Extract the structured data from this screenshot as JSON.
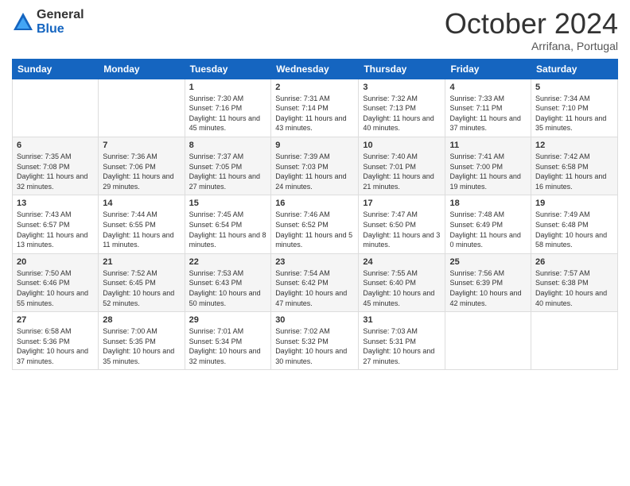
{
  "logo": {
    "general": "General",
    "blue": "Blue"
  },
  "title": "October 2024",
  "subtitle": "Arrifana, Portugal",
  "weekdays": [
    "Sunday",
    "Monday",
    "Tuesday",
    "Wednesday",
    "Thursday",
    "Friday",
    "Saturday"
  ],
  "weeks": [
    [
      {
        "day": "",
        "info": ""
      },
      {
        "day": "",
        "info": ""
      },
      {
        "day": "1",
        "info": "Sunrise: 7:30 AM\nSunset: 7:16 PM\nDaylight: 11 hours and 45 minutes."
      },
      {
        "day": "2",
        "info": "Sunrise: 7:31 AM\nSunset: 7:14 PM\nDaylight: 11 hours and 43 minutes."
      },
      {
        "day": "3",
        "info": "Sunrise: 7:32 AM\nSunset: 7:13 PM\nDaylight: 11 hours and 40 minutes."
      },
      {
        "day": "4",
        "info": "Sunrise: 7:33 AM\nSunset: 7:11 PM\nDaylight: 11 hours and 37 minutes."
      },
      {
        "day": "5",
        "info": "Sunrise: 7:34 AM\nSunset: 7:10 PM\nDaylight: 11 hours and 35 minutes."
      }
    ],
    [
      {
        "day": "6",
        "info": "Sunrise: 7:35 AM\nSunset: 7:08 PM\nDaylight: 11 hours and 32 minutes."
      },
      {
        "day": "7",
        "info": "Sunrise: 7:36 AM\nSunset: 7:06 PM\nDaylight: 11 hours and 29 minutes."
      },
      {
        "day": "8",
        "info": "Sunrise: 7:37 AM\nSunset: 7:05 PM\nDaylight: 11 hours and 27 minutes."
      },
      {
        "day": "9",
        "info": "Sunrise: 7:39 AM\nSunset: 7:03 PM\nDaylight: 11 hours and 24 minutes."
      },
      {
        "day": "10",
        "info": "Sunrise: 7:40 AM\nSunset: 7:01 PM\nDaylight: 11 hours and 21 minutes."
      },
      {
        "day": "11",
        "info": "Sunrise: 7:41 AM\nSunset: 7:00 PM\nDaylight: 11 hours and 19 minutes."
      },
      {
        "day": "12",
        "info": "Sunrise: 7:42 AM\nSunset: 6:58 PM\nDaylight: 11 hours and 16 minutes."
      }
    ],
    [
      {
        "day": "13",
        "info": "Sunrise: 7:43 AM\nSunset: 6:57 PM\nDaylight: 11 hours and 13 minutes."
      },
      {
        "day": "14",
        "info": "Sunrise: 7:44 AM\nSunset: 6:55 PM\nDaylight: 11 hours and 11 minutes."
      },
      {
        "day": "15",
        "info": "Sunrise: 7:45 AM\nSunset: 6:54 PM\nDaylight: 11 hours and 8 minutes."
      },
      {
        "day": "16",
        "info": "Sunrise: 7:46 AM\nSunset: 6:52 PM\nDaylight: 11 hours and 5 minutes."
      },
      {
        "day": "17",
        "info": "Sunrise: 7:47 AM\nSunset: 6:50 PM\nDaylight: 11 hours and 3 minutes."
      },
      {
        "day": "18",
        "info": "Sunrise: 7:48 AM\nSunset: 6:49 PM\nDaylight: 11 hours and 0 minutes."
      },
      {
        "day": "19",
        "info": "Sunrise: 7:49 AM\nSunset: 6:48 PM\nDaylight: 10 hours and 58 minutes."
      }
    ],
    [
      {
        "day": "20",
        "info": "Sunrise: 7:50 AM\nSunset: 6:46 PM\nDaylight: 10 hours and 55 minutes."
      },
      {
        "day": "21",
        "info": "Sunrise: 7:52 AM\nSunset: 6:45 PM\nDaylight: 10 hours and 52 minutes."
      },
      {
        "day": "22",
        "info": "Sunrise: 7:53 AM\nSunset: 6:43 PM\nDaylight: 10 hours and 50 minutes."
      },
      {
        "day": "23",
        "info": "Sunrise: 7:54 AM\nSunset: 6:42 PM\nDaylight: 10 hours and 47 minutes."
      },
      {
        "day": "24",
        "info": "Sunrise: 7:55 AM\nSunset: 6:40 PM\nDaylight: 10 hours and 45 minutes."
      },
      {
        "day": "25",
        "info": "Sunrise: 7:56 AM\nSunset: 6:39 PM\nDaylight: 10 hours and 42 minutes."
      },
      {
        "day": "26",
        "info": "Sunrise: 7:57 AM\nSunset: 6:38 PM\nDaylight: 10 hours and 40 minutes."
      }
    ],
    [
      {
        "day": "27",
        "info": "Sunrise: 6:58 AM\nSunset: 5:36 PM\nDaylight: 10 hours and 37 minutes."
      },
      {
        "day": "28",
        "info": "Sunrise: 7:00 AM\nSunset: 5:35 PM\nDaylight: 10 hours and 35 minutes."
      },
      {
        "day": "29",
        "info": "Sunrise: 7:01 AM\nSunset: 5:34 PM\nDaylight: 10 hours and 32 minutes."
      },
      {
        "day": "30",
        "info": "Sunrise: 7:02 AM\nSunset: 5:32 PM\nDaylight: 10 hours and 30 minutes."
      },
      {
        "day": "31",
        "info": "Sunrise: 7:03 AM\nSunset: 5:31 PM\nDaylight: 10 hours and 27 minutes."
      },
      {
        "day": "",
        "info": ""
      },
      {
        "day": "",
        "info": ""
      }
    ]
  ]
}
